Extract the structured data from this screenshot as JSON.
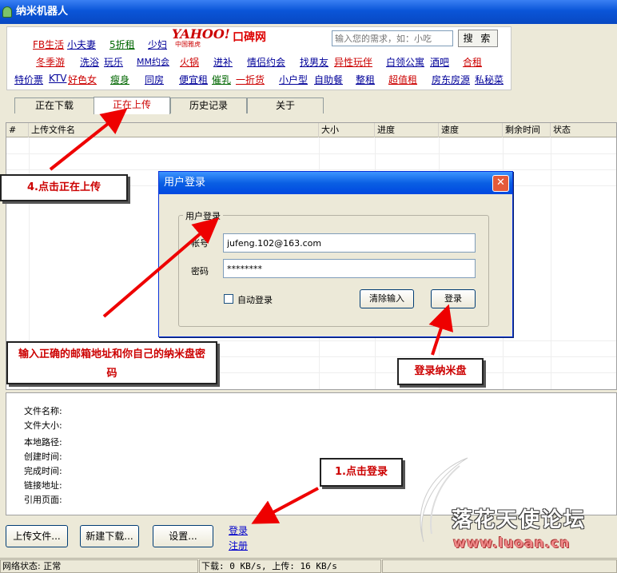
{
  "window": {
    "title": "纳米机器人",
    "icon": "robot-icon"
  },
  "ad": {
    "yahoo_logo": "YAHOO!",
    "yahoo_sub": "中国雅虎",
    "koubei_logo": "口碑网",
    "search_placeholder": "输入您的需求，如：小吃",
    "search_button": "搜 索",
    "rows": [
      [
        "FB生活",
        "小夫妻",
        "5折租",
        "少妇"
      ],
      [
        "冬季游",
        "洗浴",
        "玩乐",
        "MM约会",
        "火锅",
        "进补",
        "情侣约会",
        "找男友",
        "异性玩伴",
        "白领公寓",
        "酒吧",
        "合租"
      ],
      [
        "特价票",
        "KTV",
        "好色女",
        "瘦身",
        "同房",
        "便宜租",
        "催乳",
        "一折货",
        "小户型",
        "自助餐",
        "整租",
        "超值租",
        "房东房源",
        "私秘菜"
      ]
    ],
    "link_colors": {
      "red": "#cc0000",
      "blue": "#000099",
      "green": "#006600"
    }
  },
  "tabs": [
    {
      "label": "正在下载"
    },
    {
      "label": "正在上传"
    },
    {
      "label": "历史记录"
    },
    {
      "label": "关于"
    }
  ],
  "list": {
    "columns": [
      "#",
      "上传文件名",
      "大小",
      "进度",
      "速度",
      "剩余时间",
      "状态"
    ]
  },
  "details": {
    "fields": [
      "文件名称:",
      "文件大小:",
      "本地路径:",
      "创建时间:",
      "完成时间:",
      "链接地址:",
      "引用页面:"
    ]
  },
  "buttons": {
    "upload": "上传文件...",
    "new_download": "新建下载...",
    "settings": "设置..."
  },
  "links": {
    "login": "登录",
    "register": "注册"
  },
  "status": {
    "network": "网络状态: 正常",
    "speed": "下载: 0 KB/s, 上传: 16 KB/s"
  },
  "dialog": {
    "title": "用户登录",
    "group_label": "用户登录",
    "account_label": "帐号",
    "account_value": "jufeng.102@163.com",
    "password_label": "密码",
    "password_value": "********",
    "auto_login": "自动登录",
    "clear_button": "清除输入",
    "login_button": "登录"
  },
  "annotations": {
    "step4": "4.点击正在上传",
    "enter_credentials": "输入正确的邮箱地址和你自己的纳米盘密码",
    "login_disk": "登录纳米盘",
    "step1": "1.点击登录"
  },
  "watermark": {
    "text": "落花天使论坛",
    "url": "www.luoan.cn"
  }
}
